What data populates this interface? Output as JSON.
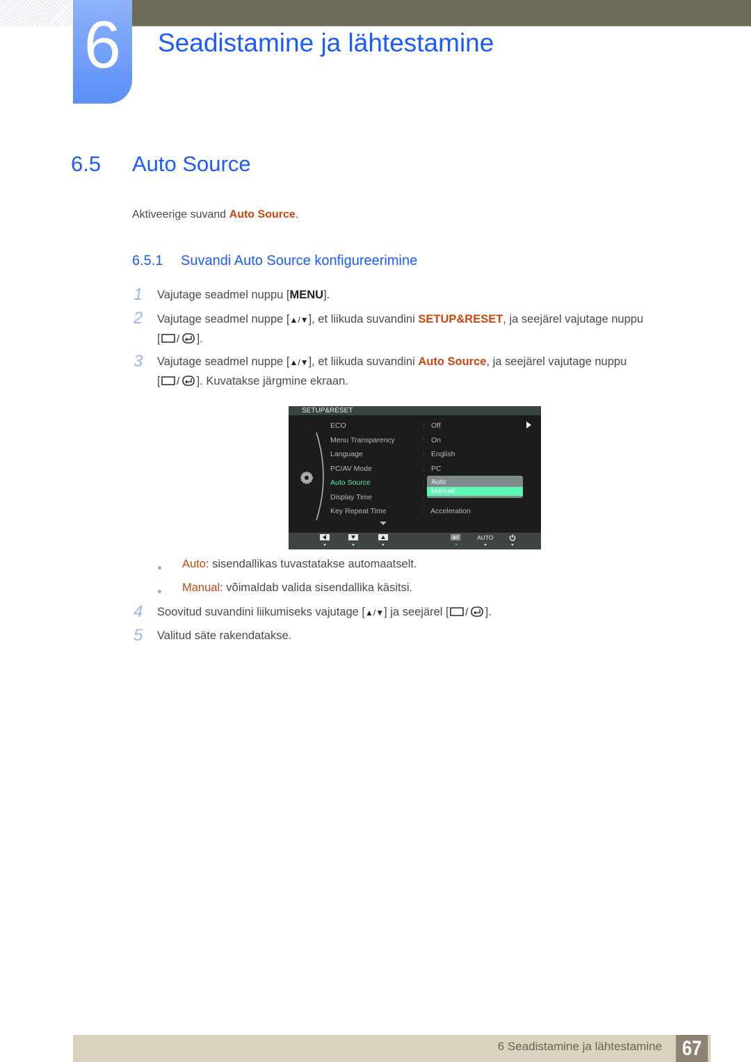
{
  "chapter": {
    "number": "6",
    "title": "Seadistamine ja lähtestamine"
  },
  "section": {
    "number": "6.5",
    "title": "Auto Source"
  },
  "intro": {
    "prefix": "Aktiveerige suvand ",
    "highlight": "Auto Source",
    "suffix": "."
  },
  "subsection": {
    "number": "6.5.1",
    "title": "Suvandi Auto Source konfigureerimine"
  },
  "steps": [
    {
      "num": "1",
      "line1_prefix": "Vajutage seadmel nuppu [",
      "key": "MENU",
      "line1_suffix": "]."
    },
    {
      "num": "2",
      "line1_prefix": "Vajutage seadmel nuppe [",
      "line1_mid": "], et liikuda suvandini ",
      "highlight": "SETUP&RESET",
      "line1_suffix": ", ja seejärel vajutage nuppu",
      "line2_suffix": "]."
    },
    {
      "num": "3",
      "line1_prefix": "Vajutage seadmel nuppe [",
      "line1_mid": "], et liikuda suvandini ",
      "highlight": "Auto Source",
      "line1_suffix": ", ja seejärel vajutage nuppu",
      "line2_suffix": "]. Kuvatakse järgmine ekraan."
    },
    {
      "num": "4",
      "line1_prefix": "Soovitud suvandini liikumiseks vajutage [",
      "line1_mid": "] ja seejärel [",
      "line1_suffix": "]."
    },
    {
      "num": "5",
      "text": "Valitud säte rakendatakse."
    }
  ],
  "bracket_open": "[",
  "slash": "/",
  "osd": {
    "header": "SETUP&RESET",
    "items": [
      {
        "label": "ECO",
        "value": "Off"
      },
      {
        "label": "Menu Transparency",
        "value": "On"
      },
      {
        "label": "Language",
        "value": "English"
      },
      {
        "label": "PC/AV Mode",
        "value": "PC"
      },
      {
        "label": "Auto Source",
        "value": ""
      },
      {
        "label": "Display Time",
        "value": ""
      },
      {
        "label": "Key Repeat Time",
        "value": "Acceleration"
      }
    ],
    "colon": ":",
    "dropdown_options": [
      "Auto",
      "Manual"
    ],
    "dropdown_selected": "Manual",
    "footer_auto": "AUTO",
    "accent_color": "#5df0a8"
  },
  "bullets": [
    {
      "term": "Auto",
      "text": ": sisendallikas tuvastatakse automaatselt."
    },
    {
      "term": "Manual",
      "text": ": võimaldab valida sisendallika käsitsi."
    }
  ],
  "footer": {
    "text": "6 Seadistamine ja lähtestamine",
    "page": "67"
  },
  "colors": {
    "heading_blue": "#1a5cff",
    "highlight_orange": "#c9470e",
    "footer_bg": "#d9d2bf",
    "page_box": "#8e8275"
  }
}
